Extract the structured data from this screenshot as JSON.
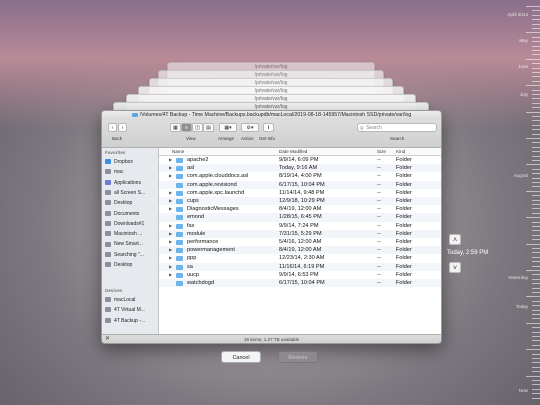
{
  "window": {
    "title": "/Volumes/4T Backup - Time Machine/Backups.backupdb/macLocal/2019-08-18-145957/Macintosh SSD/private/var/log"
  },
  "ghost_titles": [
    "/private/var/log",
    "/private/var/log",
    "/private/var/log",
    "/private/var/log",
    "/private/var/log",
    "/private/var/log"
  ],
  "toolbar": {
    "back_label": "Back",
    "view_label": "View",
    "arrange_label": "Arrange",
    "action_label": "Action",
    "getinfo_label": "Get Info",
    "search_label": "Search",
    "search_placeholder": "Search"
  },
  "sidebar": {
    "favorites_header": "Favorites",
    "favorites": [
      {
        "label": "Dropbox",
        "icon": "dropbox-icon",
        "color": "#3a8fe0"
      },
      {
        "label": "mac",
        "icon": "home-icon",
        "color": "#8a8f99"
      },
      {
        "label": "Applications",
        "icon": "applications-icon",
        "color": "#6b7bd6"
      },
      {
        "label": "all Screen S...",
        "icon": "folder-icon",
        "color": "#8a8f99"
      },
      {
        "label": "Desktop",
        "icon": "desktop-icon",
        "color": "#8a8f99"
      },
      {
        "label": "Documents",
        "icon": "documents-icon",
        "color": "#8a8f99"
      },
      {
        "label": "Downloads#1",
        "icon": "downloads-icon",
        "color": "#8a8f99"
      },
      {
        "label": "Macintosh ...",
        "icon": "disk-icon",
        "color": "#8a8f99"
      },
      {
        "label": "New Smart...",
        "icon": "gear-icon",
        "color": "#8a8f99"
      },
      {
        "label": "Searching \"...",
        "icon": "gear-icon",
        "color": "#8a8f99"
      },
      {
        "label": "Desktop",
        "icon": "folder-icon",
        "color": "#8a8f99"
      }
    ],
    "devices_header": "Devices",
    "devices": [
      {
        "label": "macLocal",
        "icon": "computer-icon",
        "color": "#8a8f99"
      },
      {
        "label": "4T Virtual M...",
        "icon": "disk-icon",
        "color": "#8a8f99"
      },
      {
        "label": "4T Backup -...",
        "icon": "time-machine-disk-icon",
        "color": "#8a8f99"
      }
    ]
  },
  "list": {
    "headers": {
      "name": "Name",
      "date": "Date Modified",
      "size": "Size",
      "kind": "Kind"
    },
    "rows": [
      {
        "name": "apache2",
        "date": "9/9/14, 6:09 PM",
        "size": "--",
        "kind": "Folder",
        "disclosure": true
      },
      {
        "name": "asl",
        "date": "Today, 9:16 AM",
        "size": "--",
        "kind": "Folder",
        "disclosure": true
      },
      {
        "name": "com.apple.clouddocs.asl",
        "date": "8/19/14, 4:00 PM",
        "size": "--",
        "kind": "Folder",
        "disclosure": true
      },
      {
        "name": "com.apple.revisiond",
        "date": "6/17/15, 10:04 PM",
        "size": "--",
        "kind": "Folder",
        "disclosure": false
      },
      {
        "name": "com.apple.xpc.launchd",
        "date": "11/14/14, 9:48 PM",
        "size": "--",
        "kind": "Folder",
        "disclosure": true
      },
      {
        "name": "cups",
        "date": "12/9/18, 10:29 PM",
        "size": "--",
        "kind": "Folder",
        "disclosure": true
      },
      {
        "name": "DiagnosticMessages",
        "date": "8/4/19, 12:00 AM",
        "size": "--",
        "kind": "Folder",
        "disclosure": true
      },
      {
        "name": "emond",
        "date": "1/28/15, 6:45 PM",
        "size": "--",
        "kind": "Folder",
        "disclosure": false
      },
      {
        "name": "fax",
        "date": "9/9/14, 7:24 PM",
        "size": "--",
        "kind": "Folder",
        "disclosure": true
      },
      {
        "name": "module",
        "date": "7/31/15, 5:29 PM",
        "size": "--",
        "kind": "Folder",
        "disclosure": true
      },
      {
        "name": "performance",
        "date": "5/4/16, 12:00 AM",
        "size": "--",
        "kind": "Folder",
        "disclosure": true
      },
      {
        "name": "powermanagement",
        "date": "8/4/19, 12:00 AM",
        "size": "--",
        "kind": "Folder",
        "disclosure": true
      },
      {
        "name": "ppp",
        "date": "12/23/14, 2:30 AM",
        "size": "--",
        "kind": "Folder",
        "disclosure": true
      },
      {
        "name": "sa",
        "date": "11/16/14, 6:19 PM",
        "size": "--",
        "kind": "Folder",
        "disclosure": true
      },
      {
        "name": "uucp",
        "date": "9/9/14, 6:53 PM",
        "size": "--",
        "kind": "Folder",
        "disclosure": true
      },
      {
        "name": "watchdogd",
        "date": "6/17/15, 10:04 PM",
        "size": "--",
        "kind": "Folder",
        "disclosure": false
      }
    ]
  },
  "status": "16 items, 1.27 TB available",
  "time_machine": {
    "current_time_label": "Today, 2:59 PM",
    "cancel_label": "Cancel",
    "restore_label": "Restore",
    "timeline_labels": [
      "April 2014",
      "May",
      "June",
      "July",
      "August",
      "Yesterday",
      "Today",
      "Now"
    ]
  }
}
